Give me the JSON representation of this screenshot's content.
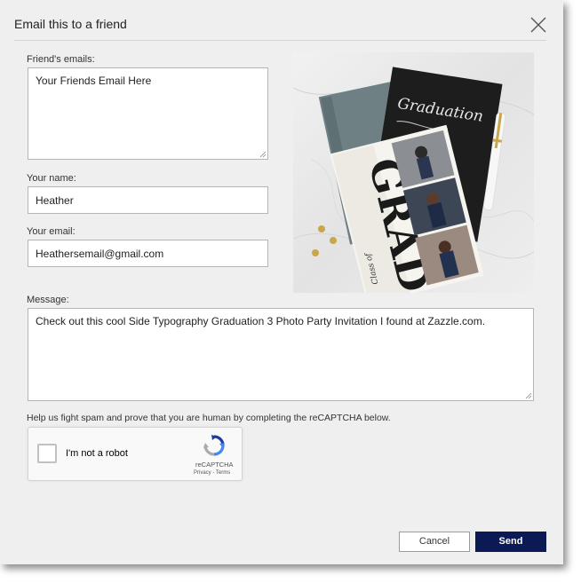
{
  "dialog": {
    "title": "Email this to a friend"
  },
  "form": {
    "friends_emails_label": "Friend's emails:",
    "friends_emails_value": "Your Friends Email Here",
    "your_name_label": "Your name:",
    "your_name_value": "Heather",
    "your_email_label": "Your email:",
    "your_email_value": "Heathersemail@gmail.com",
    "message_label": "Message:",
    "message_value": "Check out this cool Side Typography Graduation 3 Photo Party Invitation I found at Zazzle.com.",
    "spam_note": "Help us fight spam and prove that you are human by completing the reCAPTCHA below."
  },
  "product_image": {
    "alt": "Side Typography Graduation 3 Photo Party Invitation",
    "grad_text": "GRAD",
    "script_text": "Graduation",
    "class_text": "Class of"
  },
  "recaptcha": {
    "checkbox_label": "I'm not a robot",
    "brand": "reCAPTCHA",
    "privacy": "Privacy",
    "separator": " - ",
    "terms": "Terms"
  },
  "buttons": {
    "cancel": "Cancel",
    "send": "Send"
  },
  "colors": {
    "dialog_bg": "#efefef",
    "send_bg": "#0b1a54",
    "marble": "#e6e6e6"
  }
}
